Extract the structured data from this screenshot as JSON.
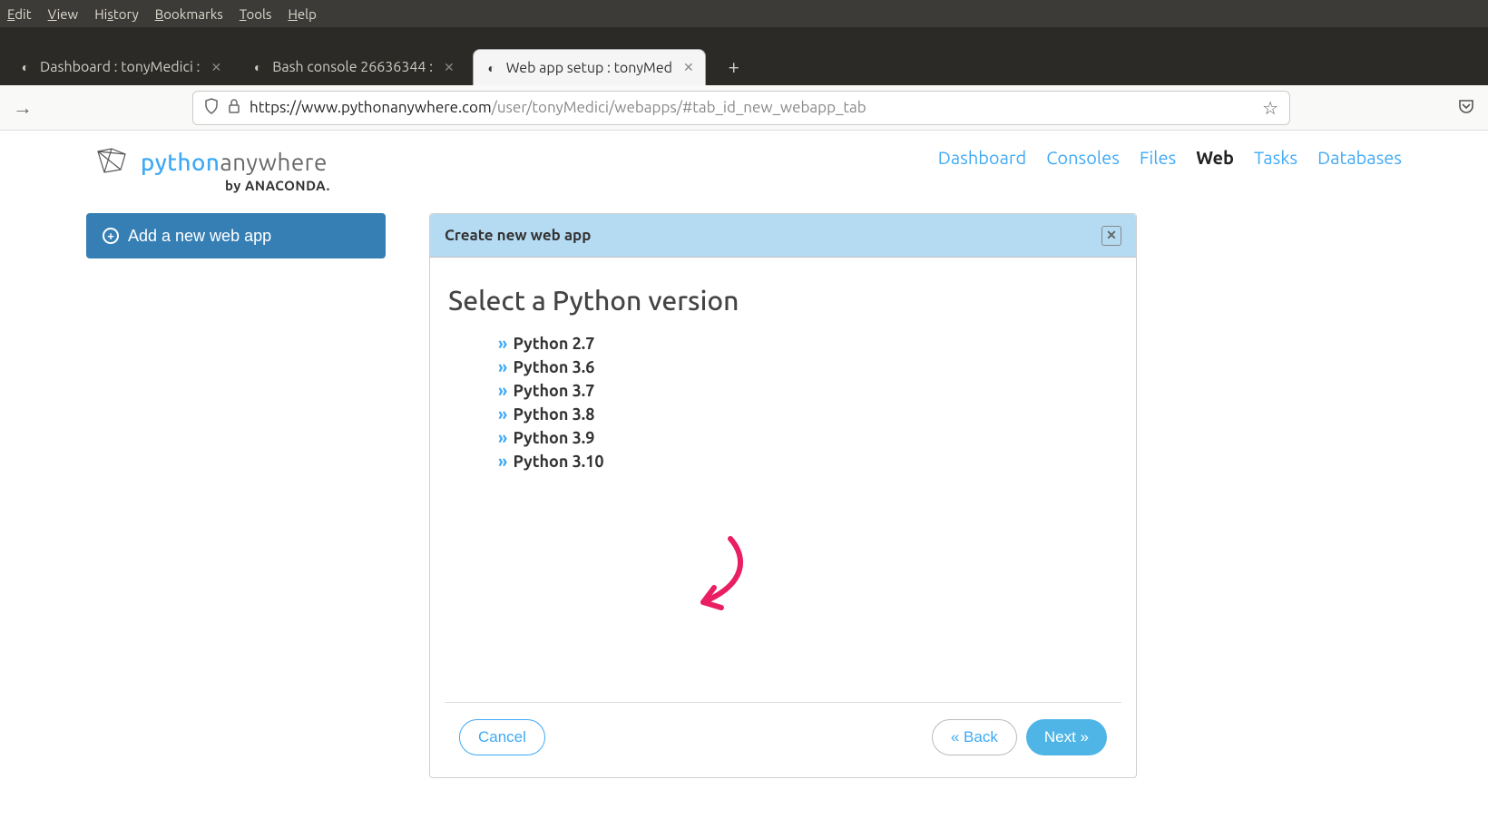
{
  "menubar": [
    "Edit",
    "View",
    "History",
    "Bookmarks",
    "Tools",
    "Help"
  ],
  "tabs": [
    {
      "label": "Dashboard : tonyMedici :",
      "active": false
    },
    {
      "label": "Bash console 26636344 :",
      "active": false
    },
    {
      "label": "Web app setup : tonyMed",
      "active": true
    }
  ],
  "url": {
    "host": "https://www.pythonanywhere.com",
    "path": "/user/tonyMedici/webapps/#tab_id_new_webapp_tab"
  },
  "logo": {
    "first": "python",
    "second": "anywhere",
    "sub_prefix": "by ",
    "sub_brand": "ANACONDA"
  },
  "topnav": [
    {
      "label": "Dashboard",
      "active": false
    },
    {
      "label": "Consoles",
      "active": false
    },
    {
      "label": "Files",
      "active": false
    },
    {
      "label": "Web",
      "active": true
    },
    {
      "label": "Tasks",
      "active": false
    },
    {
      "label": "Databases",
      "active": false
    }
  ],
  "sidebar": {
    "add_button": "Add a new web app"
  },
  "panel": {
    "header": "Create new web app",
    "heading": "Select a Python version",
    "versions": [
      "Python 2.7",
      "Python 3.6",
      "Python 3.7",
      "Python 3.8",
      "Python 3.9",
      "Python 3.10"
    ],
    "cancel": "Cancel",
    "back": "« Back",
    "next": "Next »"
  }
}
